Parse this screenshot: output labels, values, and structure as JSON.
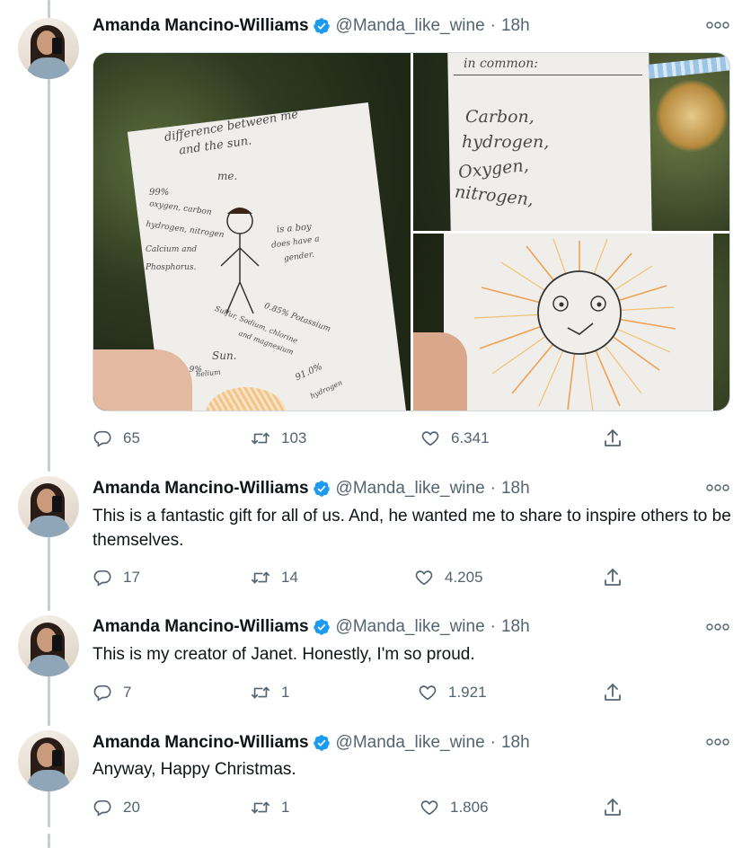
{
  "author": {
    "name": "Amanda Mancino-Williams",
    "handle": "@Manda_like_wine",
    "separator": "·",
    "time": "18h"
  },
  "tweets": [
    {
      "text": "",
      "replies": "65",
      "retweets": "103",
      "likes": "6.341",
      "media": {
        "photo1_lines": [
          "difference between me",
          "and the sun.",
          "me.",
          "99%",
          "oxygen, carbon",
          "hydrogen, nitrogen",
          "Calcium and",
          "Phosphorus.",
          "is a boy",
          "does have a",
          "gender.",
          "0.85% Potassium",
          "Sulfur, Sodium, chlorine",
          "and magnesium",
          "Sun.",
          "8.9%",
          "helium",
          "91.0%",
          "hydrogen"
        ],
        "photo2_lines": [
          "in common:",
          "Carbon,",
          "hydrogen,",
          "Oxygen,",
          "nitrogen,"
        ]
      }
    },
    {
      "text": "This is a fantastic gift for all of us. And, he wanted me to share to inspire others to be themselves.",
      "replies": "17",
      "retweets": "14",
      "likes": "4.205"
    },
    {
      "text": "This is my creator of Janet. Honestly, I'm so proud.",
      "replies": "7",
      "retweets": "1",
      "likes": "1.921"
    },
    {
      "text": "Anyway, Happy Christmas.",
      "replies": "20",
      "retweets": "1",
      "likes": "1.806"
    }
  ],
  "icons": {
    "reply": "reply-icon",
    "retweet": "retweet-icon",
    "like": "heart-icon",
    "share": "share-icon",
    "verified": "verified-badge-icon",
    "more": "more-options-icon"
  },
  "colors": {
    "verified": "#1d9bf0",
    "secondary_text": "#536471",
    "thread_line": "#c4cfd6"
  }
}
